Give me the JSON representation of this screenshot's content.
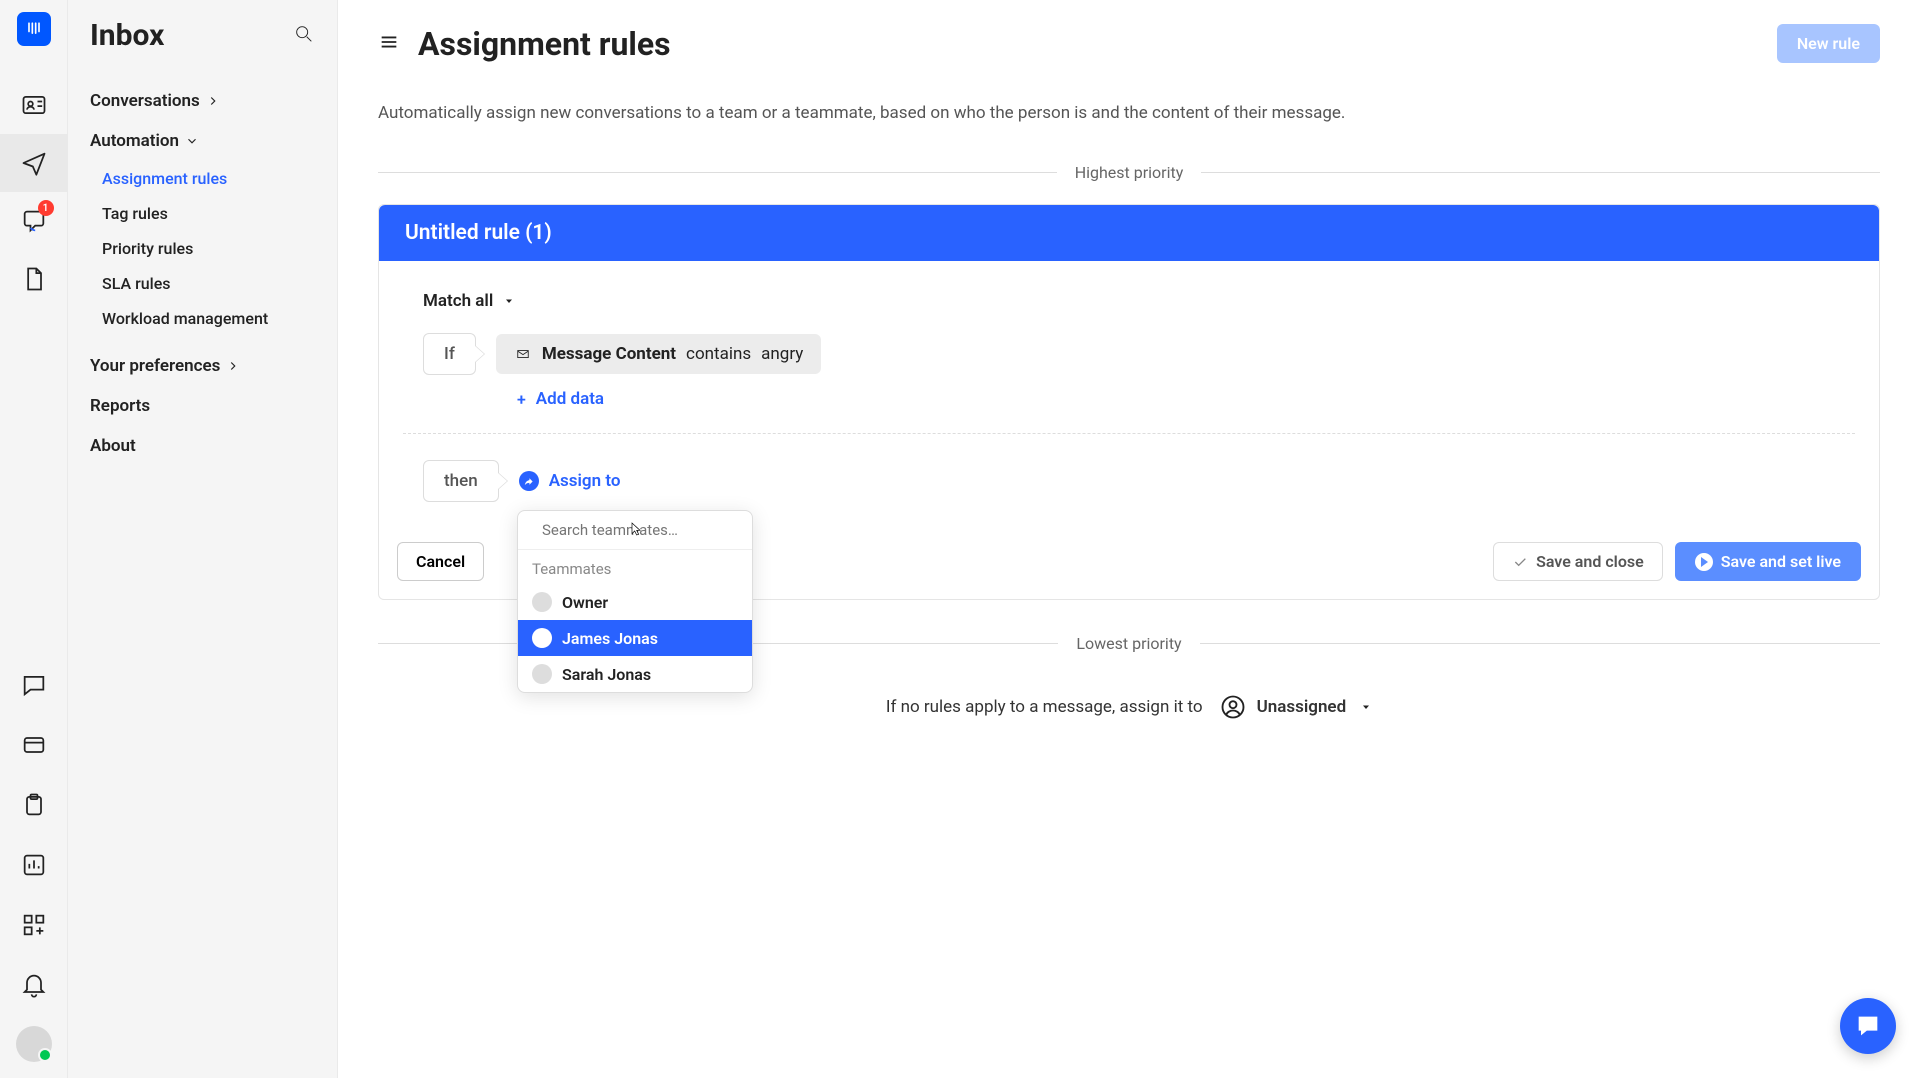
{
  "rail": {
    "badge": "1"
  },
  "sidebar": {
    "title": "Inbox",
    "conversations": "Conversations",
    "automation": "Automation",
    "subs": [
      "Assignment rules",
      "Tag rules",
      "Priority rules",
      "SLA rules",
      "Workload management"
    ],
    "prefs": "Your preferences",
    "reports": "Reports",
    "about": "About"
  },
  "main": {
    "title": "Assignment rules",
    "new_rule": "New rule",
    "desc": "Automatically assign new conversations to a team or a teammate, based on who the person is and the content of their message.",
    "highest": "Highest priority",
    "lowest": "Lowest priority"
  },
  "rule": {
    "name": "Untitled rule (1)",
    "match": "Match all",
    "if": "If",
    "then": "then",
    "chip_field": "Message Content",
    "chip_op": "contains",
    "chip_val": "angry",
    "add_data": "Add data",
    "assign_to": "Assign to",
    "cancel": "Cancel",
    "save_close": "Save and close",
    "save_live": "Save and set live"
  },
  "dropdown": {
    "placeholder": "Search teammates…",
    "heading": "Teammates",
    "items": [
      "Owner",
      "James Jonas",
      "Sarah Jonas"
    ]
  },
  "fallback": {
    "text": "If no rules apply to a message, assign it to",
    "value": "Unassigned"
  }
}
